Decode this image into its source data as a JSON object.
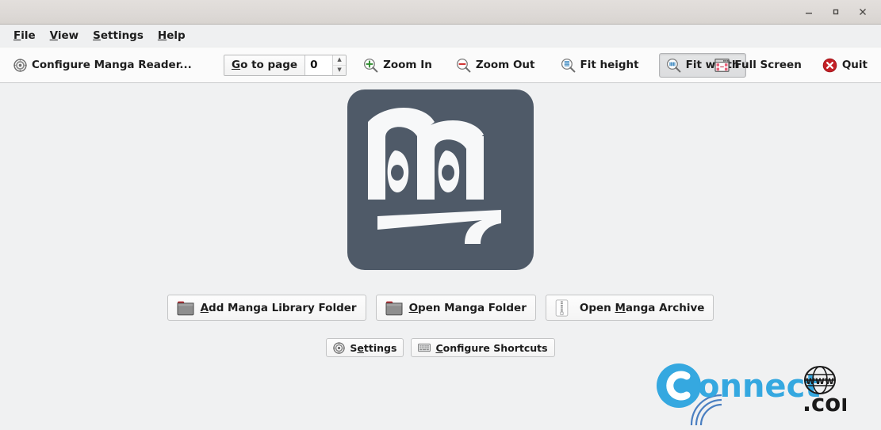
{
  "window": {
    "title": "",
    "controls": {
      "minimize": "minimize-icon",
      "maximize": "maximize-icon",
      "close": "close-icon"
    }
  },
  "menubar": {
    "items": [
      {
        "label": "File",
        "mnemonic": "F",
        "rest": "ile"
      },
      {
        "label": "View",
        "mnemonic": "V",
        "rest": "iew"
      },
      {
        "label": "Settings",
        "mnemonic": "S",
        "rest": "ettings"
      },
      {
        "label": "Help",
        "mnemonic": "H",
        "rest": "elp"
      }
    ]
  },
  "toolbar": {
    "configure": {
      "label": "Configure Manga Reader...",
      "icon": "gear-icon"
    },
    "goto_page": {
      "label_mnemonic": "G",
      "label_rest": "o to page",
      "value": "0",
      "spin_up": "▲",
      "spin_down": "▼"
    },
    "zoom_in": {
      "label": "Zoom In",
      "icon": "zoom-in-icon"
    },
    "zoom_out": {
      "label": "Zoom Out",
      "icon": "zoom-out-icon"
    },
    "fit_height": {
      "label": "Fit height",
      "icon": "fit-height-icon",
      "pressed": false
    },
    "fit_width": {
      "label": "Fit width",
      "icon": "fit-width-icon",
      "pressed": true
    },
    "full_screen": {
      "label": "Full Screen",
      "icon": "full-screen-icon"
    },
    "quit": {
      "label": "Quit",
      "icon": "quit-icon"
    }
  },
  "main": {
    "logo": {
      "name": "manga-reader-logo",
      "background": "#4f5a68",
      "glyph": "#f7f8f9"
    },
    "actions": [
      {
        "mnemonic": "A",
        "before": "",
        "rest": "dd Manga Library Folder",
        "icon": "folder-icon"
      },
      {
        "mnemonic": "O",
        "before": "",
        "rest": "pen Manga Folder",
        "icon": "folder-icon"
      },
      {
        "mnemonic": "M",
        "before": "Open ",
        "rest": "anga Archive",
        "icon": "archive-icon"
      }
    ],
    "secondary": [
      {
        "mnemonic": "e",
        "before": "S",
        "rest": "ttings",
        "icon": "gear-icon"
      },
      {
        "mnemonic": "C",
        "before": "",
        "rest": "onfigure Shortcuts",
        "icon": "keyboard-icon"
      }
    ]
  },
  "watermark": {
    "brand": "Connect",
    "initial": "C",
    "suffix": ".com",
    "www": "www",
    "color": "#35a8e0",
    "dark": "#1a1a1a"
  },
  "colors": {
    "titlebar": "#ddd9d6",
    "menubar": "#eff0f1",
    "toolbar": "#fbfbfb",
    "canvas": "#f0f1f2",
    "logo": "#4f5a68",
    "accent_green": "#2e8b2e",
    "accent_red": "#cc2222",
    "accent_blue": "#4a90c4"
  }
}
